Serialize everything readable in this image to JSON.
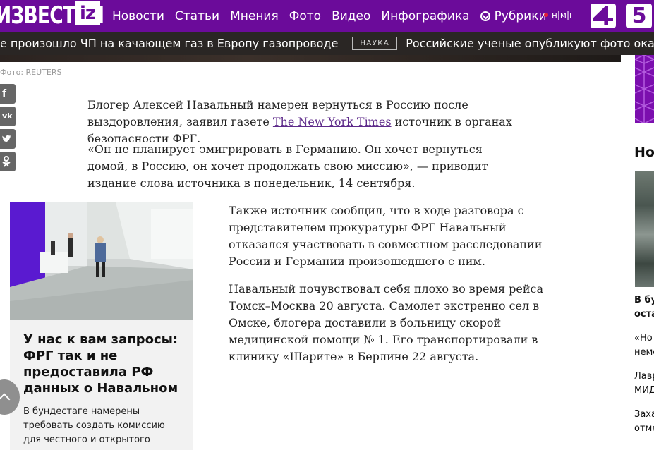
{
  "header": {
    "logo_text": "ИЗВЕСТИЯ",
    "logo_badge": "iz",
    "nav_items": [
      "Новости",
      "Статьи",
      "Мнения",
      "Фото",
      "Видео",
      "Инфографика"
    ],
    "rubrics_label": "Рубрики",
    "nmg_label": "н|м|г",
    "channel_5_label": "5",
    "brand_color": "#6b0b9a"
  },
  "ticker": {
    "headline_1": "е произошло ЧП на качающем газ в Европу газопроводе",
    "tag": "НАУКА",
    "headline_2": "Российские ученые опубликуют фото окаменелых внез"
  },
  "photo_credit": "Фото: REUTERS",
  "social_buttons": [
    "f",
    "vk",
    "tw",
    "ok"
  ],
  "article": {
    "p1_before": "Блогер Алексей Навальный намерен вернуться в Россию после выздоровления, заявил газете ",
    "p1_link": "The New York Times",
    "p1_after": " источник в органах безопасности ФРГ.",
    "p2": "«Он не планирует эмигрировать в Германию. Он хочет вернуться домой, в Россию, он хочет продолжать свою миссию», — приводит издание слова источника в понедельник, 14 сентября.",
    "p3": "Также источник сообщил, что в ходе разговора с представителем прокуратуры ФРГ Навальный отказался участвовать в совместном расследовании России и Германии произошедшего с ним.",
    "p4": "Навальный почувствовал себя плохо во время рейса Томск–Москва 20 августа. Самолет экстренно сел в Омске, блогера доставили в больницу скорой медицинской помощи № 1. Его транспортировали в клинику «Шарите» в Берлине 22 августа."
  },
  "related_card": {
    "title": "У нас к вам запросы: ФРГ так и не предоставила РФ данных о Навальном",
    "description": "В бундестаге намерены требовать создать комиссию для честного и открытого"
  },
  "right_column": {
    "heading": "Но",
    "bold_line_1": "В бу",
    "bold_line_2": "оста",
    "item_1_a": "«Но",
    "item_1_b": "немо",
    "item_2_a": "Лавр",
    "item_2_b": "МИД",
    "item_3_a": "Заха",
    "item_3_b": "отме"
  }
}
